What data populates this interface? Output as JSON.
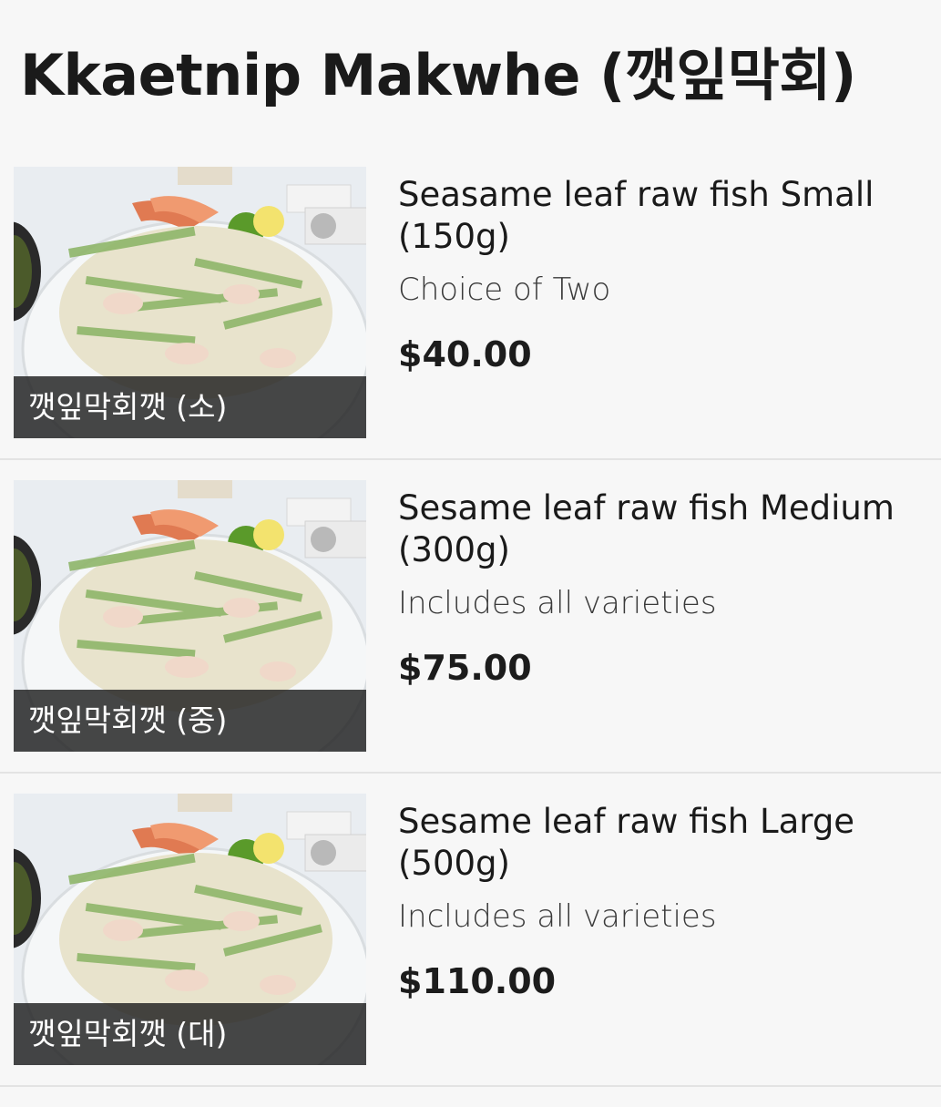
{
  "page": {
    "title": "Kkaetnip Makwhe (깻잎막회)"
  },
  "menu_items": [
    {
      "name": "Seasame leaf raw fish Small (150g)",
      "description": "Choice of Two",
      "price": "$40.00",
      "image_caption": "깻잎막회깻 (소)"
    },
    {
      "name": "Sesame leaf raw fish Medium (300g)",
      "description": "Includes all varieties",
      "price": "$75.00",
      "image_caption": "깻잎막회깻 (중)"
    },
    {
      "name": "Sesame leaf raw fish Large (500g)",
      "description": "Includes all varieties",
      "price": "$110.00",
      "image_caption": "깻잎막회깻 (대)"
    }
  ],
  "colors": {
    "background": "#f7f7f7",
    "divider": "#e3e3e3",
    "caption_overlay": "#1e1e1e",
    "text": "#1a1a1a"
  }
}
